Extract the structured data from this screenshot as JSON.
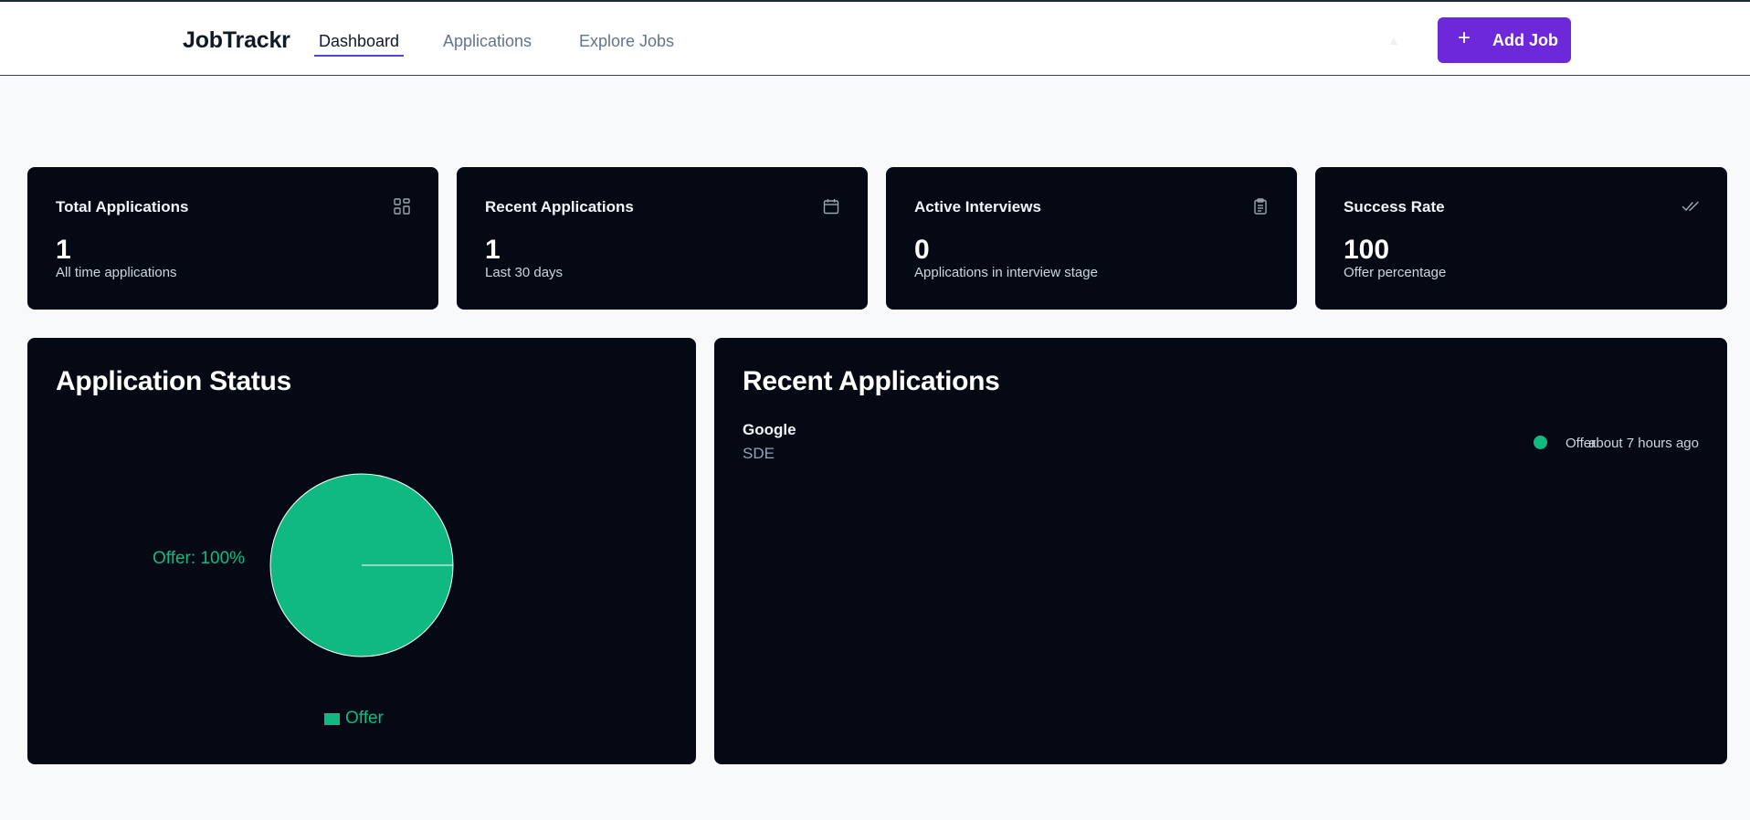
{
  "header": {
    "brand": "JobTrackr",
    "nav": [
      {
        "label": "Dashboard",
        "active": true
      },
      {
        "label": "Applications",
        "active": false
      },
      {
        "label": "Explore Jobs",
        "active": false
      }
    ],
    "add_button_label": "Add Job",
    "add_button_icon": "plus-icon"
  },
  "stats": [
    {
      "title": "Total Applications",
      "value": "1",
      "subtitle": "All time applications",
      "icon": "grid-icon"
    },
    {
      "title": "Recent Applications",
      "value": "1",
      "subtitle": "Last 30 days",
      "icon": "calendar-icon"
    },
    {
      "title": "Active Interviews",
      "value": "0",
      "subtitle": "Applications in interview stage",
      "icon": "clipboard-icon"
    },
    {
      "title": "Success Rate",
      "value": "100",
      "subtitle": "Offer percentage",
      "icon": "double-check-icon"
    }
  ],
  "status_panel": {
    "title": "Application Status"
  },
  "chart_data": {
    "type": "pie",
    "title": "Application Status",
    "slices": [
      {
        "label": "Offer",
        "value": 100,
        "color": "#10b981"
      }
    ],
    "slice_labels": [
      "Offer: 100%"
    ],
    "legend": [
      "Offer"
    ],
    "legend_position": "bottom"
  },
  "recent_panel": {
    "title": "Recent Applications",
    "items": [
      {
        "company": "Google",
        "role": "SDE",
        "status": "Offer",
        "status_color": "#10b981",
        "time": "about 7 hours ago"
      }
    ]
  },
  "colors": {
    "accent": "#6d28d9",
    "nav_underline": "#4f46e5",
    "card_bg": "#050914",
    "offer": "#10b981"
  }
}
